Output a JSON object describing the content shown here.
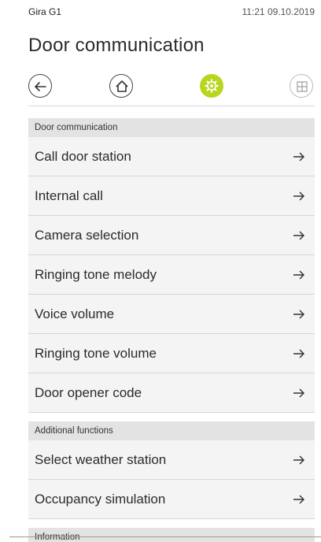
{
  "status": {
    "device": "Gira G1",
    "clock": "11:21 09.10.2019"
  },
  "page": {
    "title": "Door communication"
  },
  "nav": {
    "back_icon": "arrow-left-icon",
    "home_icon": "house-icon",
    "settings_icon": "gear-icon",
    "grid_icon": "grid-icon",
    "active_color": "#b7d61e"
  },
  "sections": {
    "door": {
      "header": "Door communication",
      "items": [
        "Call door station",
        "Internal call",
        "Camera selection",
        "Ringing tone melody",
        "Voice volume",
        "Ringing tone volume",
        "Door opener code"
      ]
    },
    "additional": {
      "header": "Additional functions",
      "items": [
        "Select weather station",
        "Occupancy simulation"
      ]
    },
    "information": {
      "header": "Information"
    }
  }
}
